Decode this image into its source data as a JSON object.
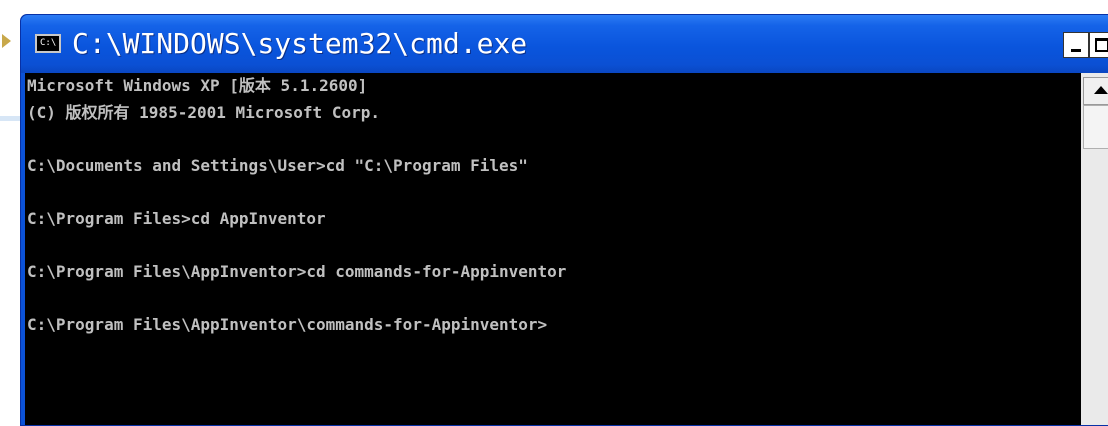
{
  "window": {
    "title": "C:\\WINDOWS\\system32\\cmd.exe",
    "icon_label": "C:\\",
    "icon_name": "console-app-icon",
    "titlebar_color": "#0a55dd"
  },
  "controls": {
    "minimize_icon": "minimize-icon",
    "maximize_icon": "maximize-icon",
    "close_label": "×"
  },
  "console": {
    "background": "#000000",
    "text_color": "#c0c0c0",
    "lines": [
      "Microsoft Windows XP [版本 5.1.2600]",
      "(C) 版权所有 1985-2001 Microsoft Corp.",
      "",
      "C:\\Documents and Settings\\User>cd \"C:\\Program Files\"",
      "",
      "C:\\Program Files>cd AppInventor",
      "",
      "C:\\Program Files\\AppInventor>cd commands-for-Appinventor",
      "",
      "C:\\Program Files\\AppInventor\\commands-for-Appinventor>",
      "",
      ""
    ]
  },
  "scrollbar": {
    "up_arrow_icon": "scroll-up-arrow-icon"
  }
}
